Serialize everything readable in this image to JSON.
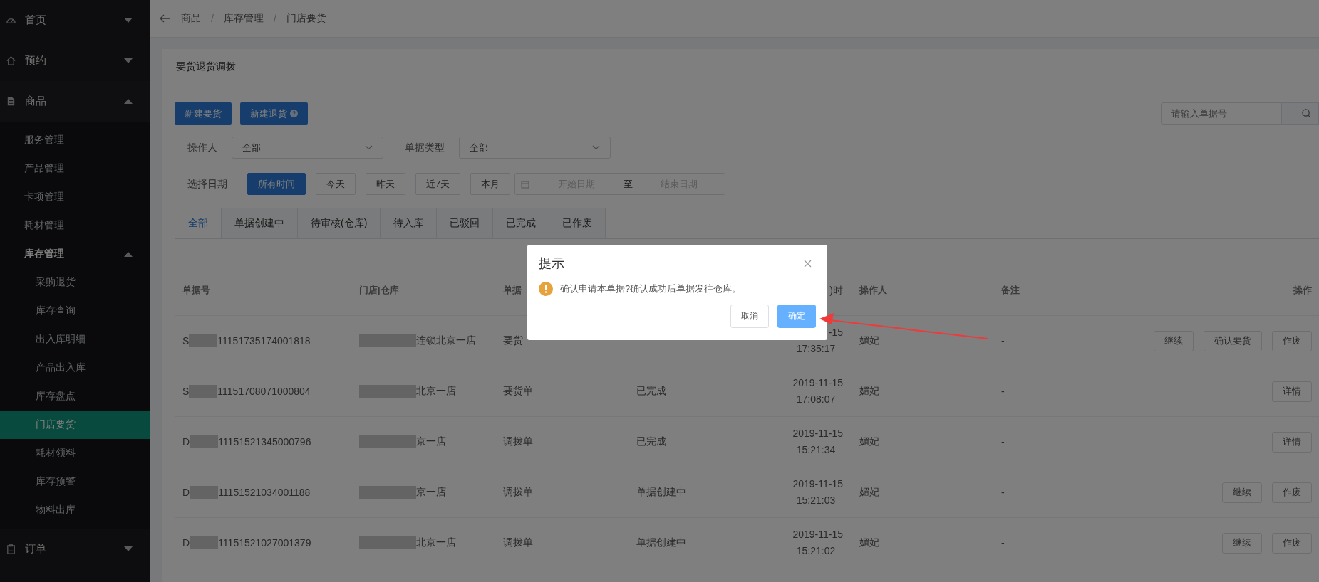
{
  "sidebar": {
    "items": [
      {
        "label": "首页",
        "expanded": false
      },
      {
        "label": "预约",
        "expanded": false
      },
      {
        "label": "商品",
        "expanded": true,
        "children": [
          {
            "label": "服务管理",
            "selected": false
          },
          {
            "label": "产品管理",
            "selected": false
          },
          {
            "label": "卡项管理",
            "selected": false
          },
          {
            "label": "耗材管理",
            "selected": false
          },
          {
            "label": "库存管理",
            "expanded": true,
            "children": [
              {
                "label": "采购退货",
                "selected": false
              },
              {
                "label": "库存查询",
                "selected": false
              },
              {
                "label": "出入库明细",
                "selected": false
              },
              {
                "label": "产品出入库",
                "selected": false
              },
              {
                "label": "库存盘点",
                "selected": false
              },
              {
                "label": "门店要货",
                "selected": true
              },
              {
                "label": "耗材领料",
                "selected": false
              },
              {
                "label": "库存预警",
                "selected": false
              },
              {
                "label": "物料出库",
                "selected": false
              }
            ]
          }
        ]
      },
      {
        "label": "订单",
        "expanded": false
      }
    ]
  },
  "breadcrumb": {
    "separator": "/",
    "items": [
      "商品",
      "库存管理",
      "门店要货"
    ]
  },
  "card": {
    "title": "要货退货调拨"
  },
  "buttons": [
    {
      "label": "新建要货",
      "help": false
    },
    {
      "label": "新建退货",
      "help": true
    }
  ],
  "search": {
    "placeholder": "请输入单据号"
  },
  "filters": [
    {
      "label": "操作人",
      "value": "全部"
    },
    {
      "label": "单据类型",
      "value": "全部"
    }
  ],
  "date_filter": {
    "label": "选择日期",
    "options": [
      {
        "label": "所有时间",
        "selected": true
      },
      {
        "label": "今天",
        "selected": false
      },
      {
        "label": "昨天",
        "selected": false
      },
      {
        "label": "近7天",
        "selected": false
      },
      {
        "label": "本月",
        "selected": false
      }
    ],
    "start_placeholder": "开始日期",
    "separator": "至",
    "end_placeholder": "结束日期"
  },
  "tabs": [
    {
      "label": "全部",
      "selected": true
    },
    {
      "label": "单据创建中",
      "selected": false
    },
    {
      "label": "待审核(仓库)",
      "selected": false
    },
    {
      "label": "待入库",
      "selected": false
    },
    {
      "label": "已驳回",
      "selected": false
    },
    {
      "label": "已完成",
      "selected": false
    },
    {
      "label": "已作废",
      "selected": false
    }
  ],
  "table": {
    "columns": [
      "单据号",
      "门店|仓库",
      "单据",
      ")时",
      "操作人",
      "备注",
      "操作"
    ],
    "rows": [
      {
        "number_prefix": "S",
        "number": "11151735174001818",
        "store": "连锁北京一店",
        "type": "要货",
        "date": "-15",
        "time": "17:35:17",
        "operator": "媚妃",
        "remark": "-",
        "actions": [
          "继续",
          "确认要货",
          "作废"
        ]
      },
      {
        "number_prefix": "S",
        "number": "11151708071000804",
        "store": "北京一店",
        "type": "要货单",
        "status": "已完成",
        "date": "2019-11-15",
        "time": "17:08:07",
        "operator": "媚妃",
        "remark": "-",
        "actions": [
          "详情"
        ]
      },
      {
        "number_prefix": "D",
        "number": "11151521345000796",
        "store": "京一店",
        "type": "调拨单",
        "status": "已完成",
        "date": "2019-11-15",
        "time": "15:21:34",
        "operator": "媚妃",
        "remark": "-",
        "actions": [
          "详情"
        ]
      },
      {
        "number_prefix": "D",
        "number": "11151521034001188",
        "store": "京一店",
        "type": "调拨单",
        "status": "单据创建中",
        "date": "2019-11-15",
        "time": "15:21:03",
        "operator": "媚妃",
        "remark": "-",
        "actions": [
          "继续",
          "作废"
        ]
      },
      {
        "number_prefix": "D",
        "number": "11151521027001379",
        "store": "北京一店",
        "type": "调拨单",
        "status": "单据创建中",
        "date": "2019-11-15",
        "time": "15:21:02",
        "operator": "媚妃",
        "remark": "-",
        "actions": [
          "继续",
          "作废"
        ]
      }
    ]
  },
  "dialog": {
    "title": "提示",
    "message": "确认申请本单据?确认成功后单据发往仓库。",
    "buttons": [
      {
        "label": "取消",
        "primary": false
      },
      {
        "label": "确定",
        "primary": true
      }
    ]
  }
}
